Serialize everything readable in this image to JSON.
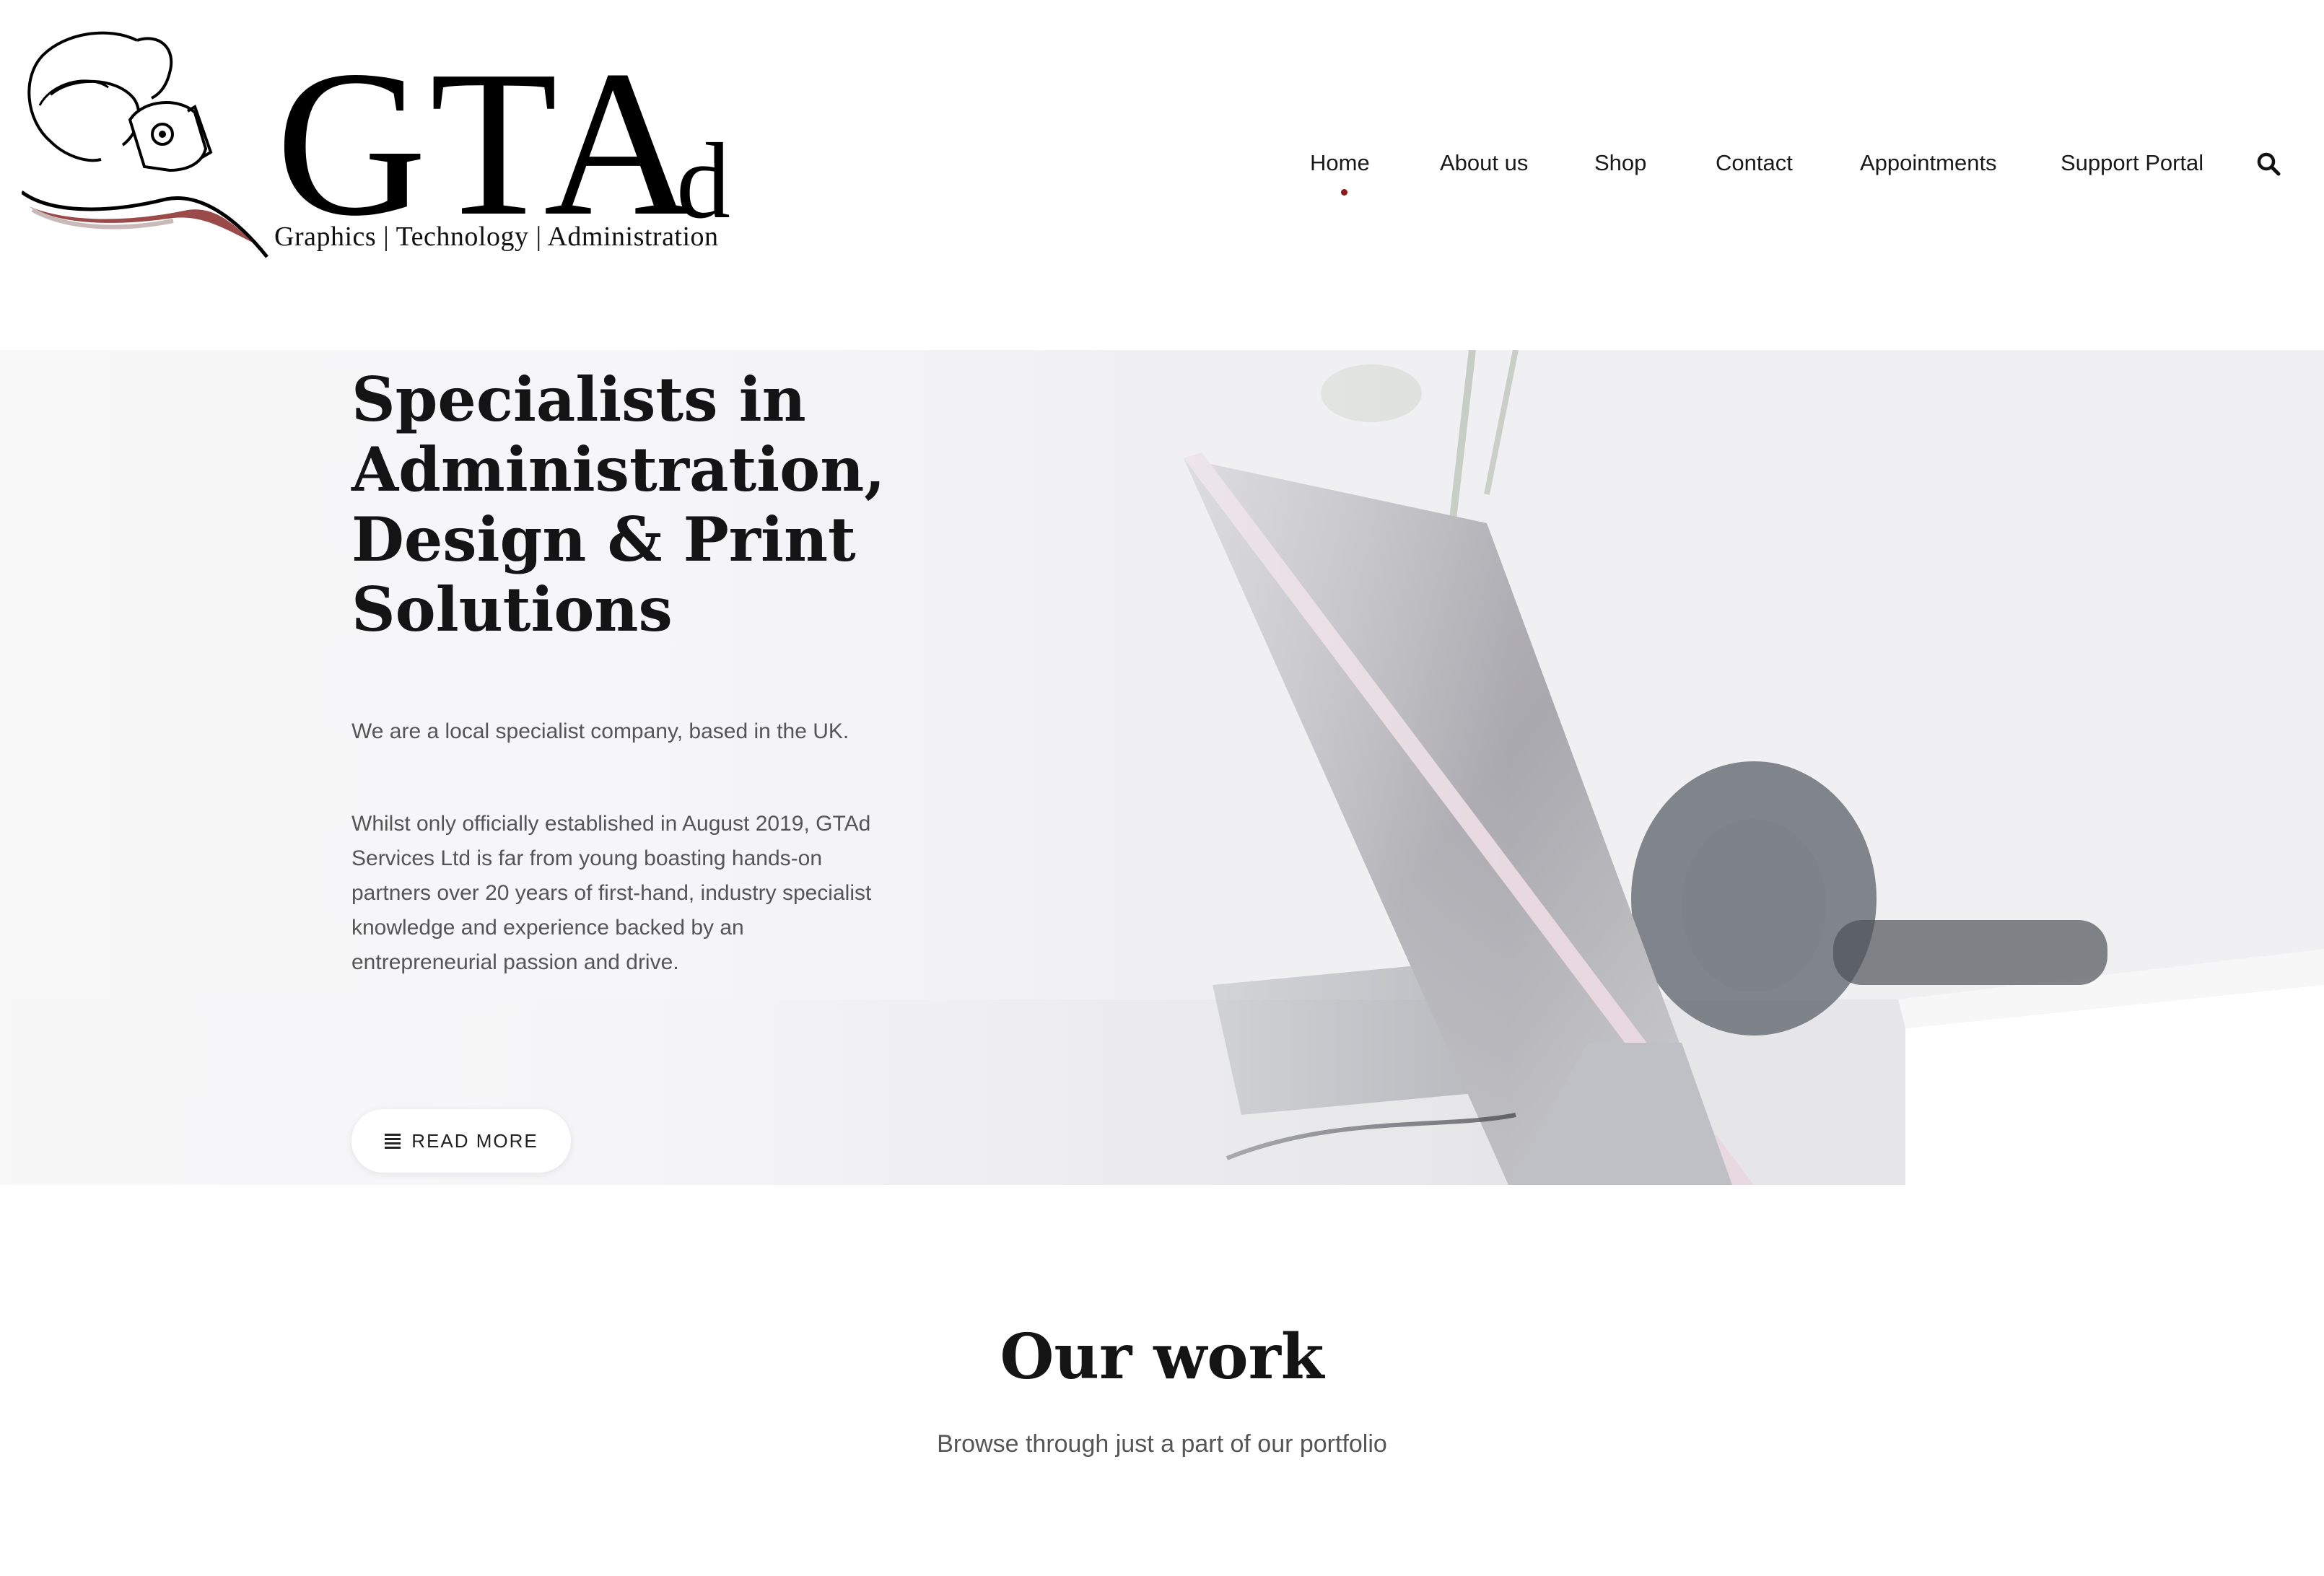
{
  "brand": {
    "logo_word": "GTA",
    "logo_sub": "d",
    "tagline": "Graphics | Technology | Administration"
  },
  "nav": {
    "items": [
      {
        "label": "Home",
        "active": true
      },
      {
        "label": "About us"
      },
      {
        "label": "Shop"
      },
      {
        "label": "Contact"
      },
      {
        "label": "Appointments"
      },
      {
        "label": "Support Portal"
      }
    ],
    "search_icon": "search-icon",
    "active_color": "#8b1a1a"
  },
  "hero": {
    "title": "Specialists in Administration, Design & Print Solutions",
    "paragraph1": "We are a local specialist company, based in the UK.",
    "paragraph2": "Whilst only officially established in August 2019, GTAd Services Ltd is far from young boasting hands-on partners over 20 years of first-hand, industry specialist knowledge and experience backed by an entrepreneurial passion and drive.",
    "button_label": "READ MORE",
    "button_icon": "list-icon"
  },
  "work": {
    "title": "Our work",
    "subtitle": "Browse through just a part of our portfolio"
  }
}
